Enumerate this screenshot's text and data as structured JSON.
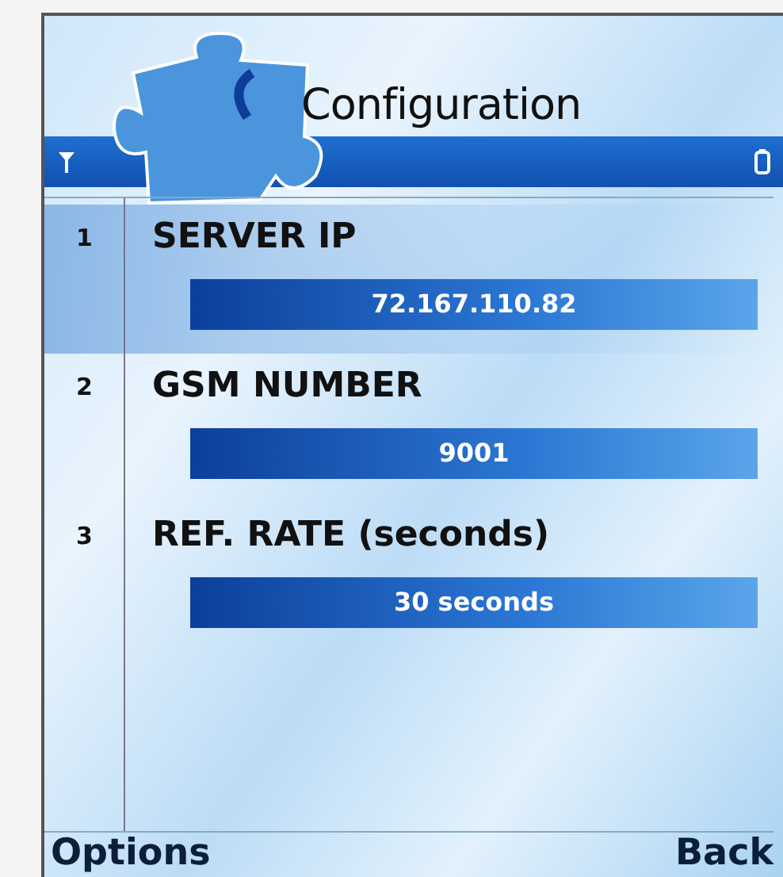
{
  "title": "Configuration",
  "settings": [
    {
      "number": "1",
      "label": "SERVER IP",
      "value": "72.167.110.82",
      "selected": true
    },
    {
      "number": "2",
      "label": "GSM NUMBER",
      "value": "9001",
      "selected": false
    },
    {
      "number": "3",
      "label": "REF. RATE (seconds)",
      "value": "30 seconds",
      "selected": false
    }
  ],
  "softkeys": {
    "left": "Options",
    "right": "Back"
  }
}
